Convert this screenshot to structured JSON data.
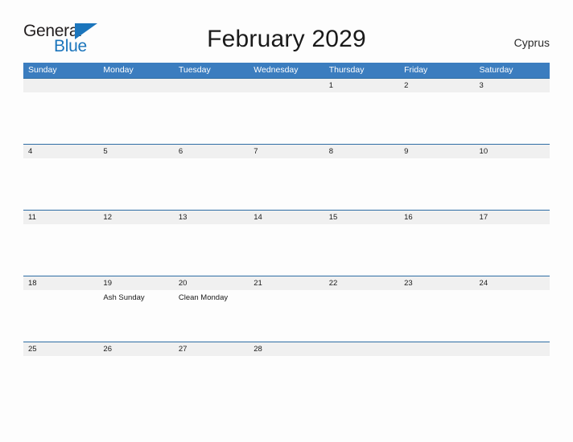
{
  "brand": {
    "name_part1": "General",
    "name_part2": "Blue",
    "flag_icon": "blue-triangle-flag-icon",
    "color_primary": "#1b75bc"
  },
  "header": {
    "title": "February 2029",
    "country": "Cyprus"
  },
  "colors": {
    "header_bar": "#3b7dbf",
    "week_separator": "#2e6da4",
    "date_band": "#f0f0f0",
    "page_background": "#fdfdfd",
    "text": "#1a1a1a"
  },
  "calendar": {
    "month": "February",
    "year": "2029",
    "weekday_headers": [
      "Sunday",
      "Monday",
      "Tuesday",
      "Wednesday",
      "Thursday",
      "Friday",
      "Saturday"
    ],
    "weeks": [
      {
        "days": [
          {
            "num": "",
            "event": ""
          },
          {
            "num": "",
            "event": ""
          },
          {
            "num": "",
            "event": ""
          },
          {
            "num": "",
            "event": ""
          },
          {
            "num": "1",
            "event": ""
          },
          {
            "num": "2",
            "event": ""
          },
          {
            "num": "3",
            "event": ""
          }
        ]
      },
      {
        "days": [
          {
            "num": "4",
            "event": ""
          },
          {
            "num": "5",
            "event": ""
          },
          {
            "num": "6",
            "event": ""
          },
          {
            "num": "7",
            "event": ""
          },
          {
            "num": "8",
            "event": ""
          },
          {
            "num": "9",
            "event": ""
          },
          {
            "num": "10",
            "event": ""
          }
        ]
      },
      {
        "days": [
          {
            "num": "11",
            "event": ""
          },
          {
            "num": "12",
            "event": ""
          },
          {
            "num": "13",
            "event": ""
          },
          {
            "num": "14",
            "event": ""
          },
          {
            "num": "15",
            "event": ""
          },
          {
            "num": "16",
            "event": ""
          },
          {
            "num": "17",
            "event": ""
          }
        ]
      },
      {
        "days": [
          {
            "num": "18",
            "event": ""
          },
          {
            "num": "19",
            "event": "Ash Sunday"
          },
          {
            "num": "20",
            "event": "Clean Monday"
          },
          {
            "num": "21",
            "event": ""
          },
          {
            "num": "22",
            "event": ""
          },
          {
            "num": "23",
            "event": ""
          },
          {
            "num": "24",
            "event": ""
          }
        ]
      },
      {
        "days": [
          {
            "num": "25",
            "event": ""
          },
          {
            "num": "26",
            "event": ""
          },
          {
            "num": "27",
            "event": ""
          },
          {
            "num": "28",
            "event": ""
          },
          {
            "num": "",
            "event": ""
          },
          {
            "num": "",
            "event": ""
          },
          {
            "num": "",
            "event": ""
          }
        ]
      }
    ]
  }
}
